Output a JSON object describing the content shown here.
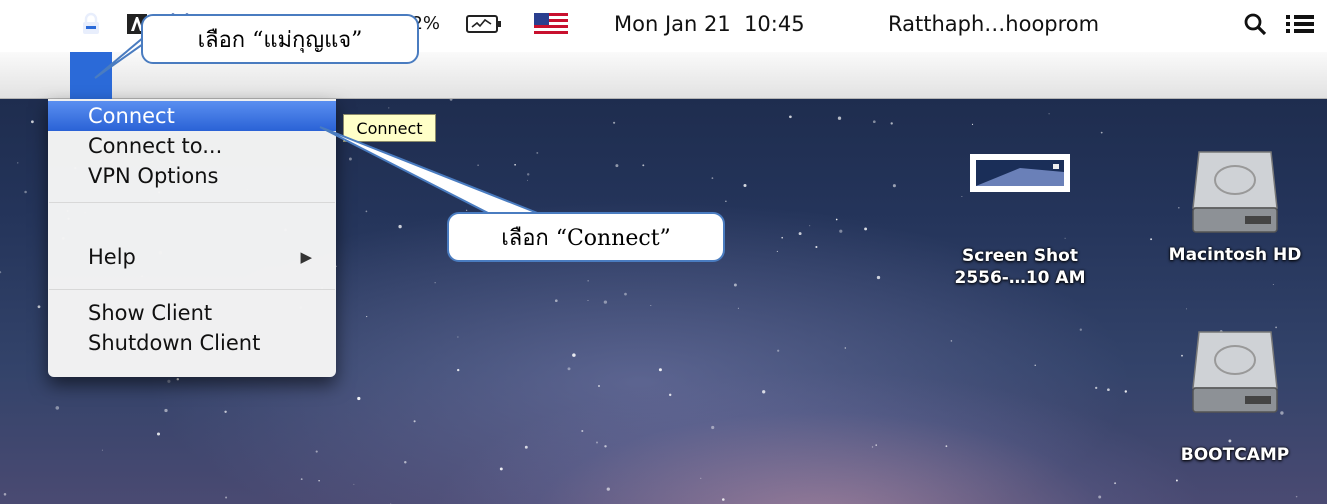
{
  "callouts": {
    "lock": "เลือก “แม่กุญแจ”",
    "connect": "เลือก “Connect”"
  },
  "menubar": {
    "icons": [
      "vpn-lock-icon",
      "adobe-icon",
      "dropbox-icon",
      "time-machine-icon",
      "bluetooth-icon",
      "wifi-icon",
      "volume-icon"
    ],
    "battery": "92%",
    "flag": "us-flag-icon",
    "datetime": "Mon Jan 21  10:45",
    "user": "Ratthaph…hooprom",
    "spotlight_icon": "search-icon",
    "notifications_icon": "list-icon",
    "accent": "#2b6ad8"
  },
  "menu": {
    "items": [
      {
        "label": "Connect"
      },
      {
        "label": "Connect to..."
      },
      {
        "label": "VPN Options"
      },
      {
        "label": "Help"
      },
      {
        "label": "Show Client"
      },
      {
        "label": "Shutdown Client"
      }
    ],
    "submenu_arrow": "▶"
  },
  "tooltip": "Connect",
  "desktop": {
    "icons": [
      {
        "line1": "Screen Shot",
        "line2": "2556-…10 AM"
      },
      {
        "line1": "Macintosh HD"
      },
      {
        "line1": "BOOTCAMP"
      }
    ]
  }
}
